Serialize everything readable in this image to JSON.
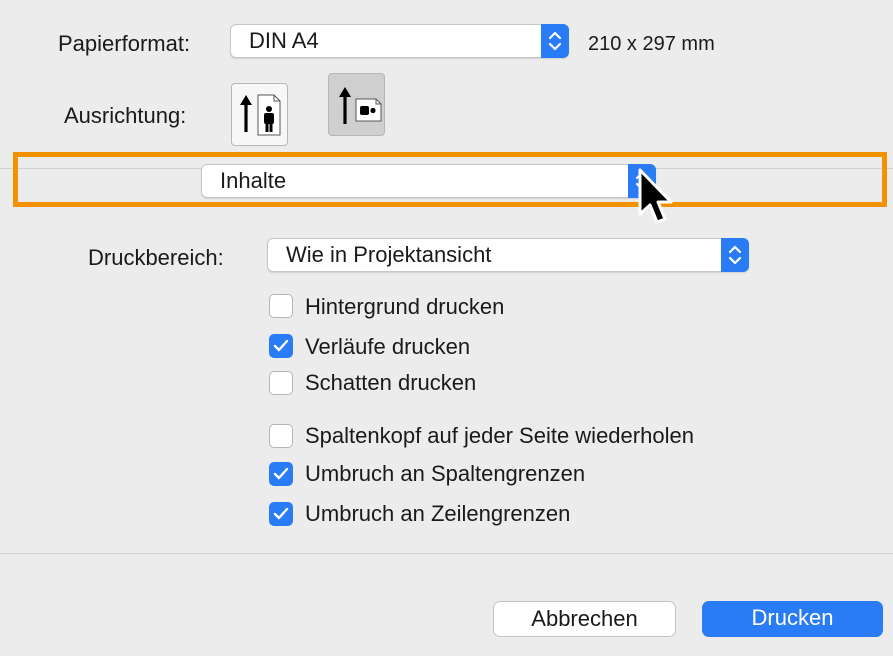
{
  "paper": {
    "label": "Papierformat:",
    "value": "DIN A4",
    "size": "210 x 297 mm"
  },
  "orientation": {
    "label": "Ausrichtung:",
    "options": [
      "portrait",
      "landscape"
    ],
    "selected": "landscape"
  },
  "section_popup": {
    "value": "Inhalte"
  },
  "print_area": {
    "label": "Druckbereich:",
    "value": "Wie in Projektansicht"
  },
  "options": [
    {
      "label": "Hintergrund drucken",
      "checked": false
    },
    {
      "label": "Verläufe drucken",
      "checked": true
    },
    {
      "label": "Schatten drucken",
      "checked": false
    },
    {
      "label": "Spaltenkopf auf jeder Seite wiederholen",
      "checked": false
    },
    {
      "label": "Umbruch an Spaltengrenzen",
      "checked": true
    },
    {
      "label": "Umbruch an Zeilengrenzen",
      "checked": true
    }
  ],
  "buttons": {
    "cancel": "Abbrechen",
    "print": "Drucken"
  },
  "colors": {
    "accent": "#2a7cf6",
    "highlight": "#f39200",
    "background": "#ececec"
  },
  "icons": [
    "chevron-up-down-icon",
    "portrait-person-icon",
    "landscape-person-icon",
    "checkmark-icon",
    "mouse-pointer-icon"
  ]
}
